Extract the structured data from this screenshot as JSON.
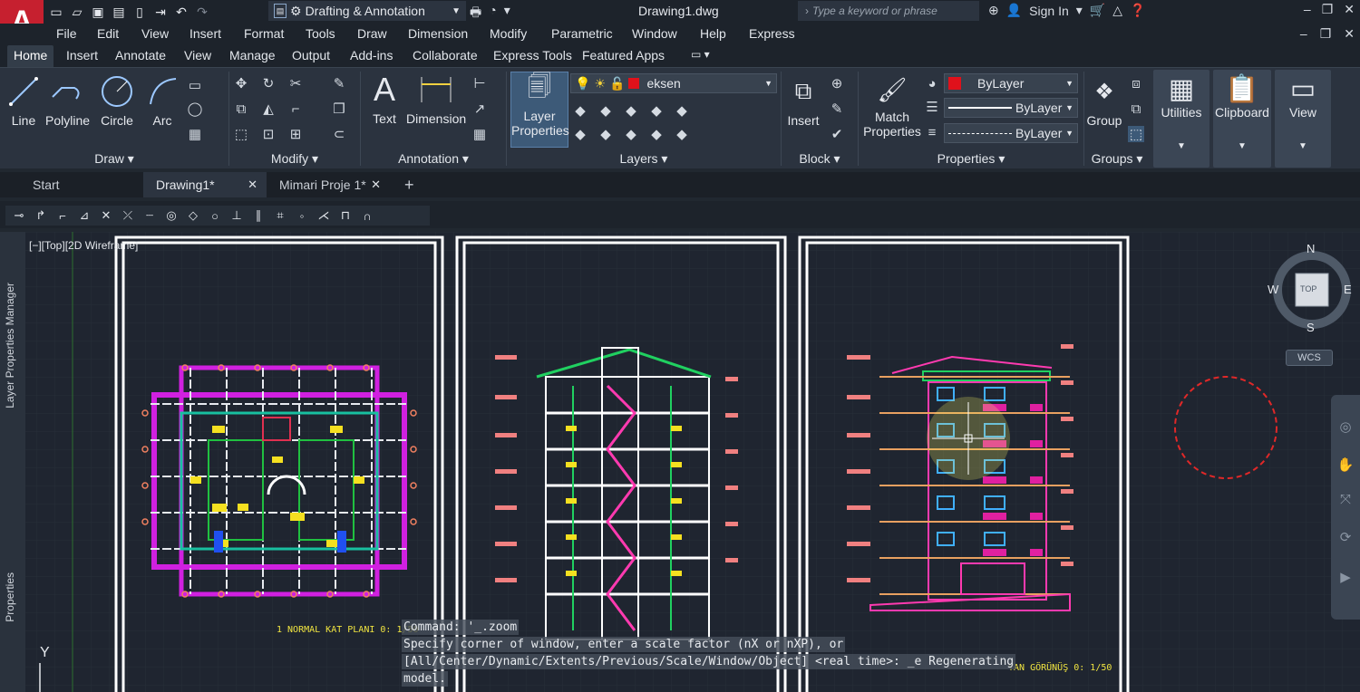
{
  "titlebar": {
    "app_letter": "A",
    "workspace": "Drafting & Annotation",
    "document": "Drawing1.dwg",
    "search_placeholder": "Type a keyword or phrase",
    "signin": "Sign In"
  },
  "menu": [
    "File",
    "Edit",
    "View",
    "Insert",
    "Format",
    "Tools",
    "Draw",
    "Dimension",
    "Modify",
    "Parametric",
    "Window",
    "Help",
    "Express"
  ],
  "ribbon_tabs": [
    "Home",
    "Insert",
    "Annotate",
    "View",
    "Manage",
    "Output",
    "Add-ins",
    "Collaborate",
    "Express Tools",
    "Featured Apps"
  ],
  "panels": {
    "draw": {
      "title": "Draw",
      "tools": [
        "Line",
        "Polyline",
        "Circle",
        "Arc"
      ]
    },
    "modify": {
      "title": "Modify"
    },
    "annotation": {
      "title": "Annotation",
      "tools": [
        "Text",
        "Dimension"
      ]
    },
    "layers": {
      "title": "Layers",
      "tool_line1": "Layer",
      "tool_line2": "Properties",
      "current_layer": "eksen"
    },
    "block": {
      "title": "Block",
      "tool": "Insert"
    },
    "properties": {
      "title": "Properties",
      "match_line1": "Match",
      "match_line2": "Properties",
      "color": "ByLayer",
      "lineweight": "ByLayer",
      "linetype": "ByLayer"
    },
    "groups": {
      "title": "Groups",
      "tool": "Group"
    },
    "utilities": {
      "title": "Utilities"
    },
    "clipboard": {
      "title": "Clipboard"
    },
    "view": {
      "title": "View"
    }
  },
  "doc_tabs": [
    {
      "label": "Start"
    },
    {
      "label": "Drawing1*"
    },
    {
      "label": "Mimari Proje 1*"
    }
  ],
  "viewport_label": "[−][Top][2D Wireframe]",
  "palettes": [
    "Layer Properties Manager",
    "Properties"
  ],
  "drawing_labels": {
    "plan": "1 NORMAL KAT PLANI 0: 1/50",
    "side": "YAN GÖRÜNÜŞ 0: 1/50"
  },
  "viewcube": {
    "n": "N",
    "s": "S",
    "e": "E",
    "w": "W",
    "face": "TOP",
    "wcs": "WCS"
  },
  "ucs": "Y",
  "command_history": [
    "Command: '_.zoom",
    "Specify corner of window, enter a scale factor (nX or nXP), or",
    "[All/Center/Dynamic/Extents/Previous/Scale/Window/Object] <real time>: _e Regenerating",
    "model."
  ],
  "colors": {
    "accent": "#c6202f",
    "current_layer_swatch": "#e0111b",
    "ribbon_bg": "#2b333f",
    "canvas_bg": "#1f2530"
  }
}
